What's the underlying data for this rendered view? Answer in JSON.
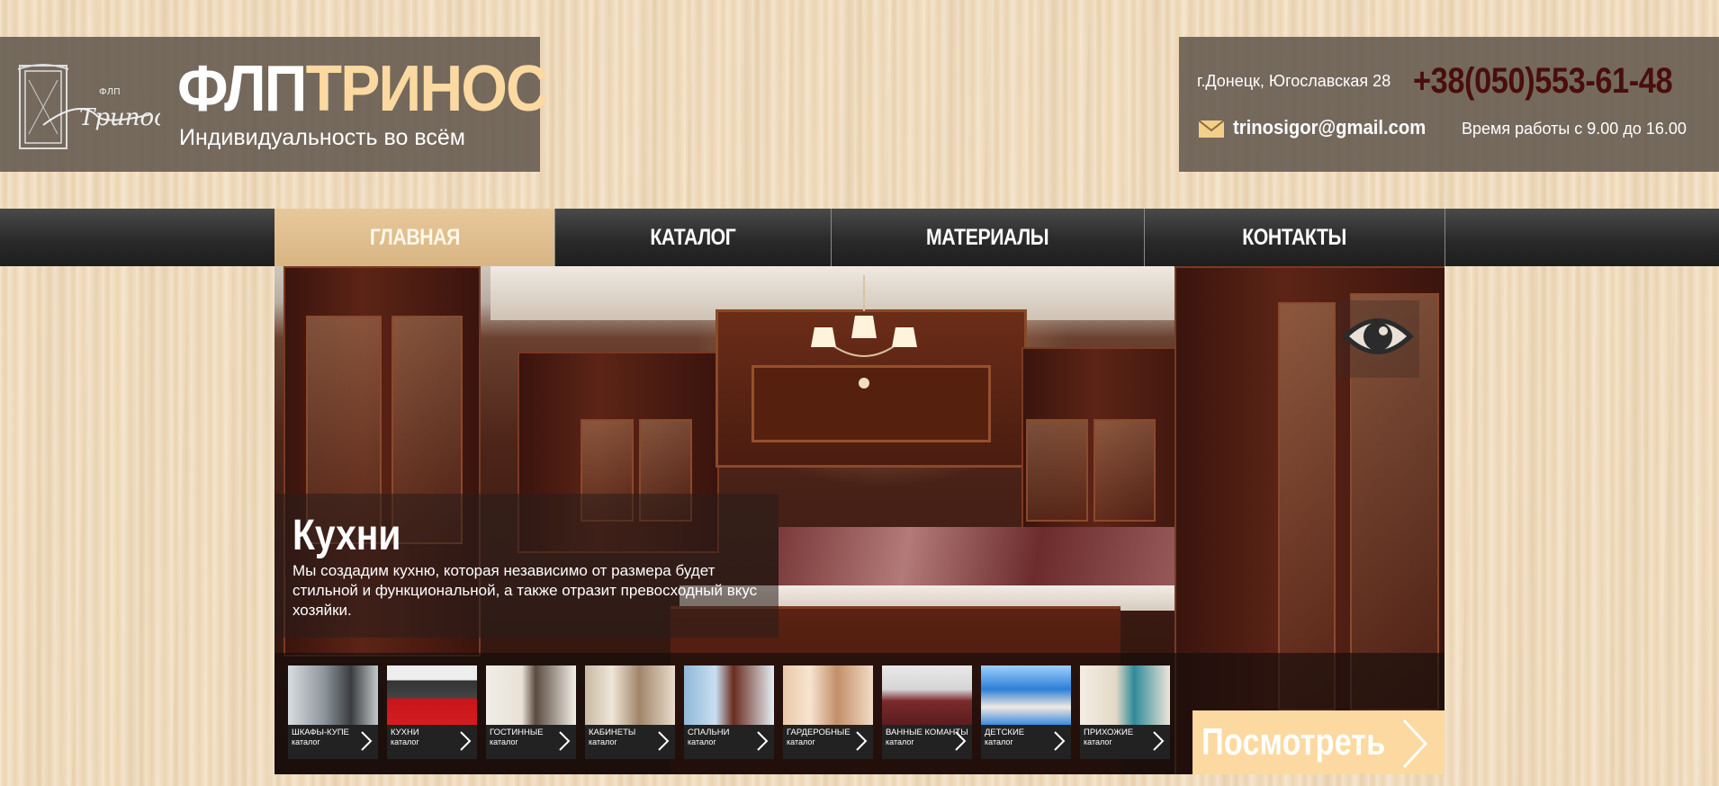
{
  "header": {
    "logo_title_part1": "ФЛП",
    "logo_title_part2": "ТРИНОС",
    "tagline": "Индивидуальность во всём",
    "emblem_text": "Триnос",
    "emblem_small": "ФЛП"
  },
  "contacts": {
    "address": "г.Донецк, Югославская 28",
    "phone": "+38(050)553-61-48",
    "email": "trinosigor@gmail.com",
    "hours": "Время работы с 9.00 до 16.00"
  },
  "nav": {
    "items": [
      {
        "label": "ГЛАВНАЯ",
        "active": true
      },
      {
        "label": "КАТАЛОГ",
        "active": false
      },
      {
        "label": "МАТЕРИАЛЫ",
        "active": false
      },
      {
        "label": "КОНТАКТЫ",
        "active": false
      }
    ]
  },
  "hero": {
    "title": "Кухни",
    "text": "Мы создадим кухню, которая независимо от размера будет стильной и функциональной, а также отразит превосходный вкус хозяйки.",
    "view_button": "Посмотреть"
  },
  "thumbnails": [
    {
      "title": "ШКАФЫ-КУПЕ",
      "sub": "каталог"
    },
    {
      "title": "КУХНИ",
      "sub": "каталог"
    },
    {
      "title": "ГОСТИННЫЕ",
      "sub": "каталог"
    },
    {
      "title": "КАБИНЕТЫ",
      "sub": "каталог"
    },
    {
      "title": "СПАЛЬНИ",
      "sub": "каталог"
    },
    {
      "title": "ГАРДЕРОБНЫЕ",
      "sub": "каталог"
    },
    {
      "title": "ВАННЫЕ КОМАНТЫ",
      "sub": "каталог"
    },
    {
      "title": "ДЕТСКИЕ",
      "sub": "каталог"
    },
    {
      "title": "ПРИХОЖИЕ",
      "sub": "каталог"
    }
  ],
  "colors": {
    "accent": "#fcd9a0",
    "phone": "#4a0d0d",
    "nav_active": "#e2c190"
  },
  "icons": {
    "mail": "mail-icon",
    "eye": "eye-icon",
    "arrow": "chevron-right-icon"
  }
}
